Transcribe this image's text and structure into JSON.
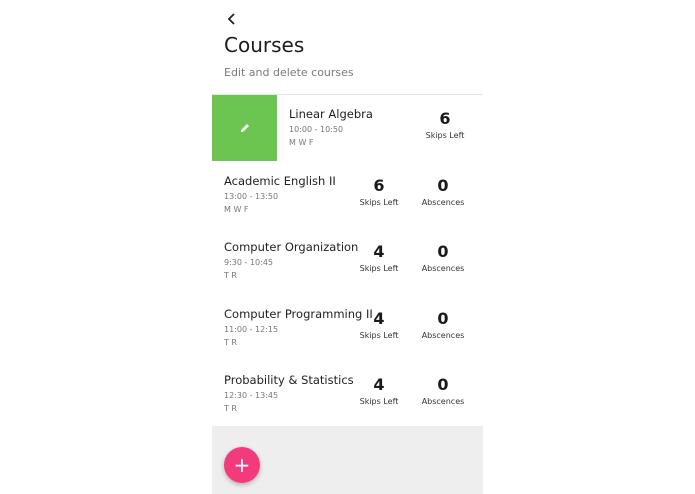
{
  "header": {
    "back_icon": "back-arrow-icon",
    "title": "Courses",
    "subtitle": "Edit and delete courses"
  },
  "courses": [
    {
      "name": "Linear Algebra",
      "time": "10:00 - 10:50",
      "days": "M W F",
      "skips_left": "6",
      "skips_label": "Skips Left",
      "swiped": true,
      "edit_icon": "pencil-icon"
    },
    {
      "name": "Academic English II",
      "time": "13:00 - 13:50",
      "days": "M W F",
      "skips_left": "6",
      "skips_label": "Skips Left",
      "absences": "0",
      "absences_label": "Abscences"
    },
    {
      "name": "Computer Organization",
      "time": "9:30 - 10:45",
      "days": "T R",
      "skips_left": "4",
      "skips_label": "Skips Left",
      "absences": "0",
      "absences_label": "Abscences"
    },
    {
      "name": "Computer Programming II",
      "time": "11:00 - 12:15",
      "days": "T R",
      "skips_left": "4",
      "skips_label": "Skips Left",
      "absences": "0",
      "absences_label": "Abscences"
    },
    {
      "name": "Probability & Statistics",
      "time": "12:30 - 13:45",
      "days": "T R",
      "skips_left": "4",
      "skips_label": "Skips Left",
      "absences": "0",
      "absences_label": "Abscences"
    }
  ],
  "fab": {
    "icon": "plus-icon",
    "label": "+"
  },
  "colors": {
    "edit_green": "#6cc550",
    "fab_pink": "#f23a7c",
    "footer_gray": "#eeeeee"
  }
}
